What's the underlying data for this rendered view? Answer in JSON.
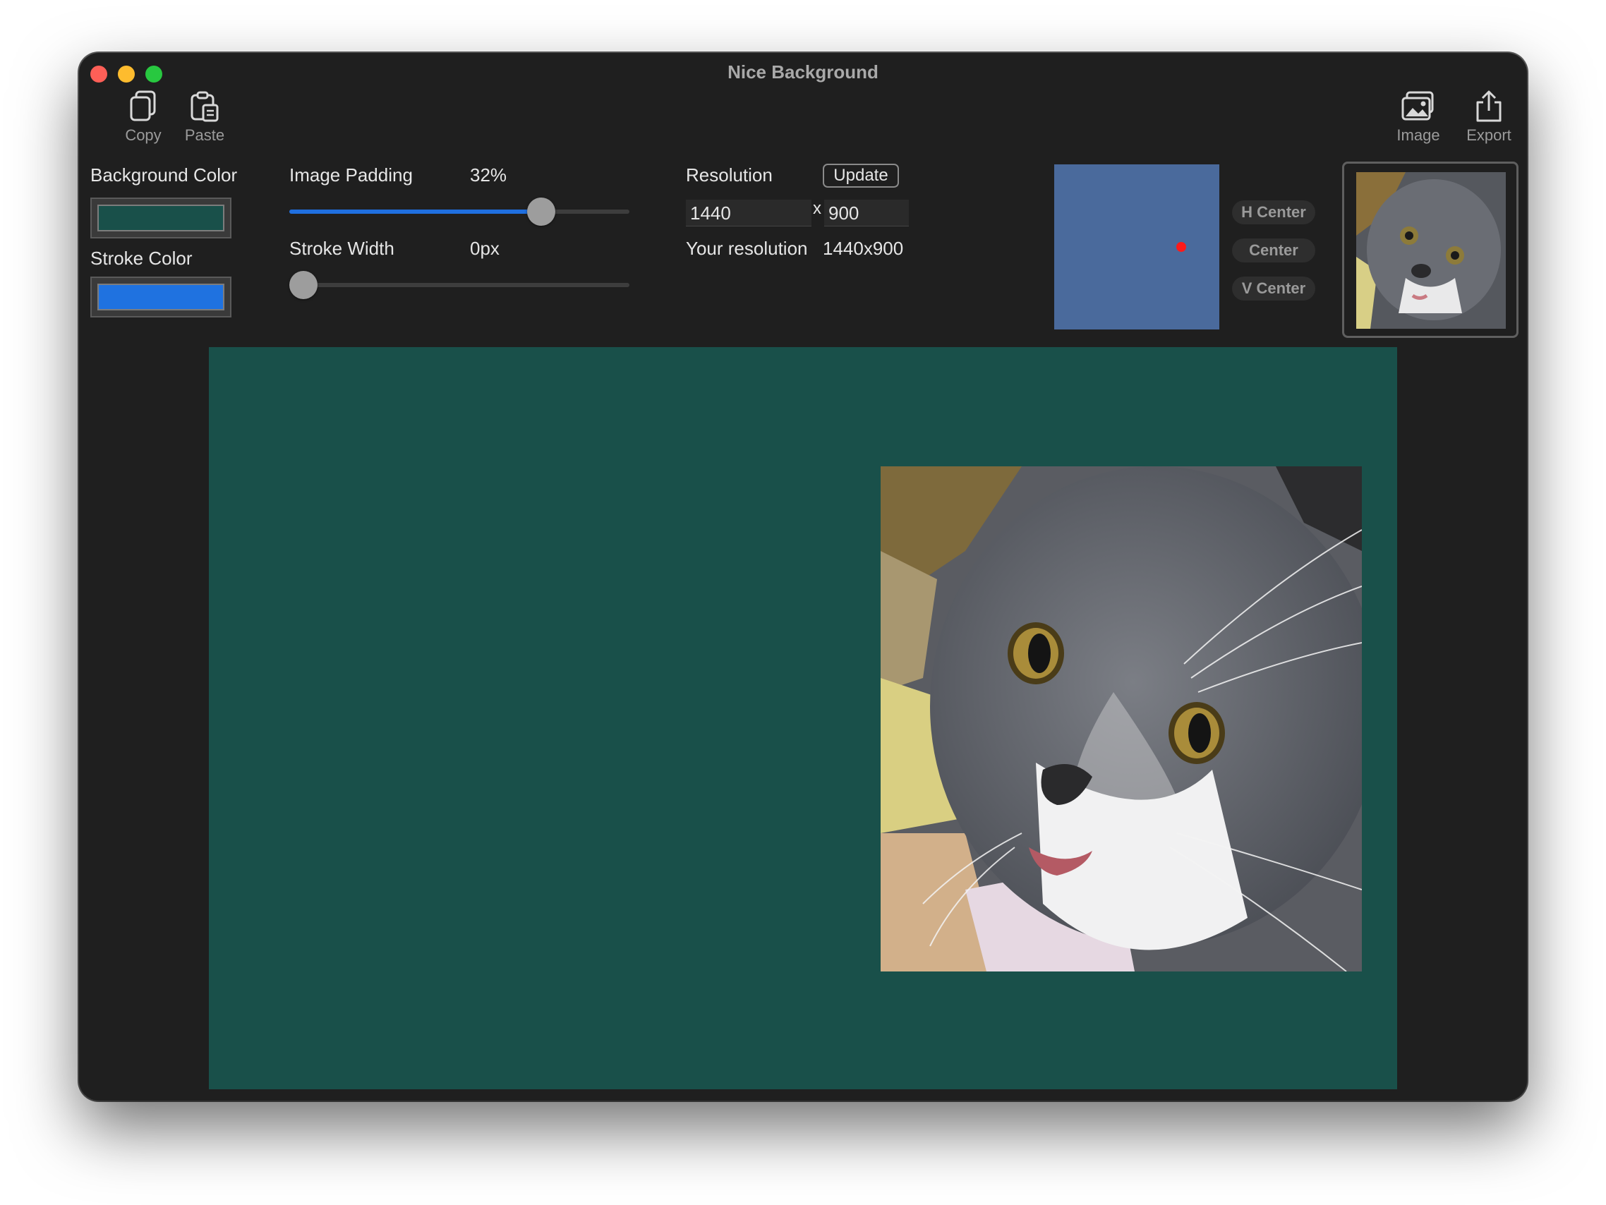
{
  "window": {
    "title": "Nice Background"
  },
  "toolbar": {
    "copy_label": "Copy",
    "paste_label": "Paste",
    "image_label": "Image",
    "export_label": "Export"
  },
  "background_color": {
    "label": "Background Color",
    "value": "#19504a"
  },
  "stroke_color": {
    "label": "Stroke Color",
    "value": "#1f72e0"
  },
  "image_padding": {
    "label": "Image Padding",
    "value_text": "32%",
    "fraction": 0.74
  },
  "stroke_width": {
    "label": "Stroke Width",
    "value_text": "0px",
    "fraction": 0.0
  },
  "resolution": {
    "label": "Resolution",
    "update_label": "Update",
    "width": "1440",
    "separator": "x",
    "height": "900",
    "your_label": "Your resolution",
    "your_value": "1440x900"
  },
  "position": {
    "dot_x": 0.77,
    "dot_y": 0.5
  },
  "alignment": {
    "h_center": "H Center",
    "center": "Center",
    "v_center": "V Center"
  },
  "colors": {
    "position_box": "#4a6a9c",
    "canvas": "#19504a",
    "accent": "#1f6fe0"
  }
}
